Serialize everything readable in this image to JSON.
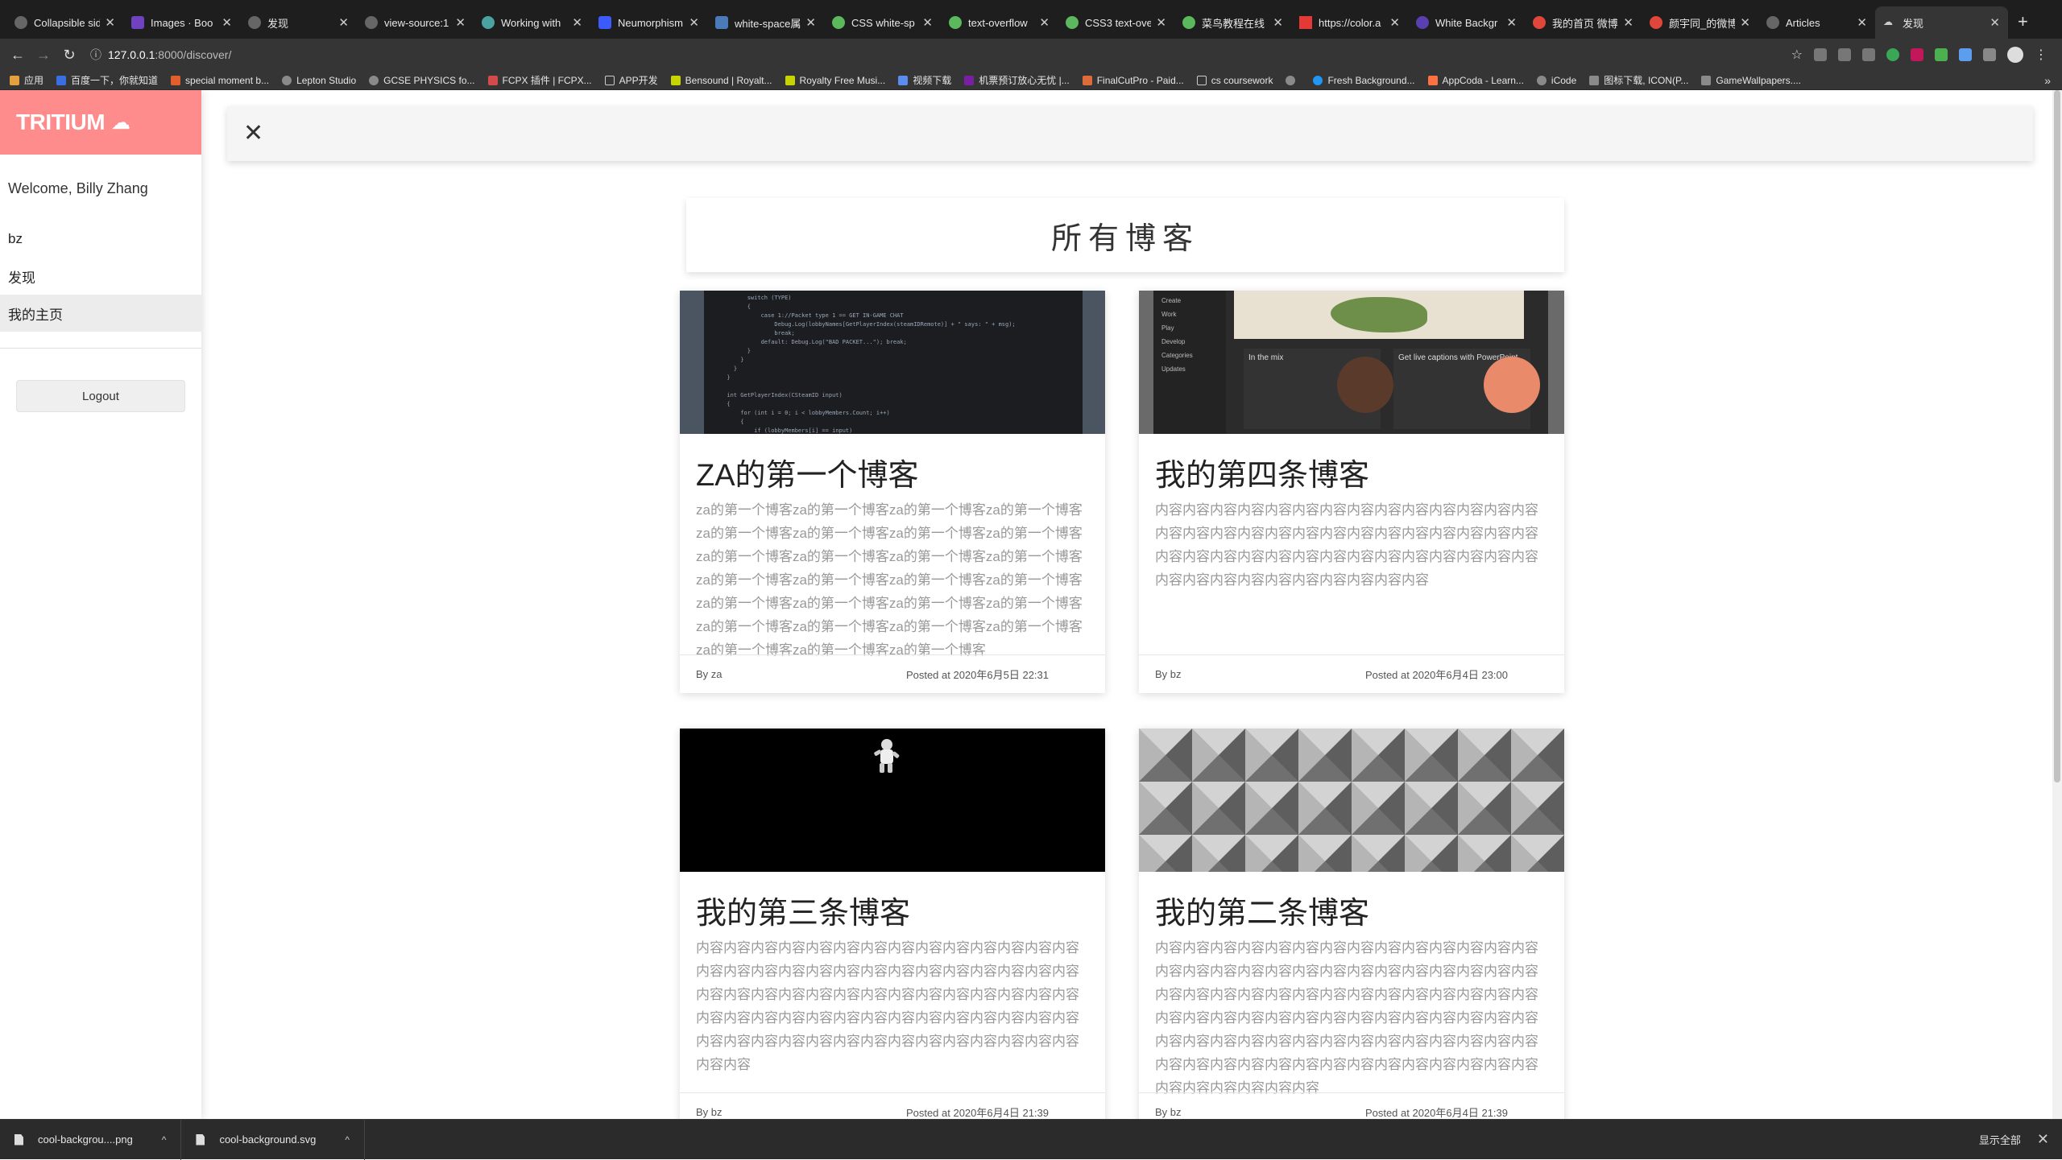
{
  "browser": {
    "tabs": [
      {
        "title": "Collapsible sid"
      },
      {
        "title": "Images · Boo"
      },
      {
        "title": "发现"
      },
      {
        "title": "view-source:1"
      },
      {
        "title": "Working with"
      },
      {
        "title": "Neumorphism"
      },
      {
        "title": "white-space属"
      },
      {
        "title": "CSS white-sp"
      },
      {
        "title": "text-overflow"
      },
      {
        "title": "CSS3 text-ove"
      },
      {
        "title": "菜鸟教程在线"
      },
      {
        "title": "https://color.a"
      },
      {
        "title": "White Backgr"
      },
      {
        "title": "我的首页 微博"
      },
      {
        "title": "颜宇同_的微博"
      },
      {
        "title": "Articles"
      },
      {
        "title": "发现"
      }
    ],
    "url_host": "127.0.0.1",
    "url_path": ":8000/discover/",
    "bookmarks": [
      "应用",
      "百度一下，你就知道",
      "special moment b...",
      "Lepton Studio",
      "GCSE PHYSICS fo...",
      "FCPX 插件 | FCPX...",
      "APP开发",
      "Bensound | Royalt...",
      "Royalty Free Musi...",
      "视频下载",
      "机票预订放心无忧 |...",
      "FinalCutPro - Paid...",
      "cs coursework",
      "",
      "Fresh Background...",
      "AppCoda - Learn...",
      "iCode",
      "图标下载, ICON(P...",
      "GameWallpapers...."
    ]
  },
  "sidebar": {
    "brand": "TRITIUM",
    "welcome": "Welcome, Billy Zhang",
    "items": [
      "bz",
      "发现",
      "我的主页"
    ],
    "logout": "Logout"
  },
  "main": {
    "heading": "所有博客",
    "posts": [
      {
        "title": "ZA的第一个博客",
        "body": "za的第一个博客za的第一个博客za的第一个博客za的第一个博客za的第一个博客za的第一个博客za的第一个博客za的第一个博客za的第一个博客za的第一个博客za的第一个博客za的第一个博客za的第一个博客za的第一个博客za的第一个博客za的第一个博客za的第一个博客za的第一个博客za的第一个博客za的第一个博客za的第一个博客za的第一个博客za的第一个博客za的第一个博客za的第一个博客za的第一个博客za的第一个博客",
        "author": "By za",
        "posted": "Posted at 2020年6月5日 22:31"
      },
      {
        "title": "我的第四条博客",
        "body": "内容内容内容内容内容内容内容内容内容内容内容内容内容内容内容内容内容内容内容内容内容内容内容内容内容内容内容内容内容内容内容内容内容内容内容内容内容内容内容内容内容内容内容内容内容内容内容内容内容内容内容内容",
        "author": "By bz",
        "posted": "Posted at 2020年6月4日 23:00"
      },
      {
        "title": "我的第三条博客",
        "body": "内容内容内容内容内容内容内容内容内容内容内容内容内容内容内容内容内容内容内容内容内容内容内容内容内容内容内容内容内容内容内容内容内容内容内容内容内容内容内容内容内容内容内容内容内容内容内容内容内容内容内容内容内容内容内容内容内容内容内容内容内容内容内容内容内容内容内容内容内容内容内容内容",
        "author": "By bz",
        "posted": "Posted at 2020年6月4日 21:39"
      },
      {
        "title": "我的第二条博客",
        "body": "内容内容内容内容内容内容内容内容内容内容内容内容内容内容内容内容内容内容内容内容内容内容内容内容内容内容内容内容内容内容内容内容内容内容内容内容内容内容内容内容内容内容内容内容内容内容内容内容内容内容内容内容内容内容内容内容内容内容内容内容内容内容内容内容内容内容内容内容内容内容内容内容内容内容内容内容内容内容内容内容内容内容内容内容内容内容内容内容内容内容",
        "author": "By bz",
        "posted": "Posted at 2020年6月4日 21:39"
      }
    ]
  },
  "downloads": {
    "items": [
      "cool-backgrou....png",
      "cool-background.svg"
    ],
    "show_all": "显示全部"
  },
  "colors": {
    "brand": "#ff8c8c"
  }
}
